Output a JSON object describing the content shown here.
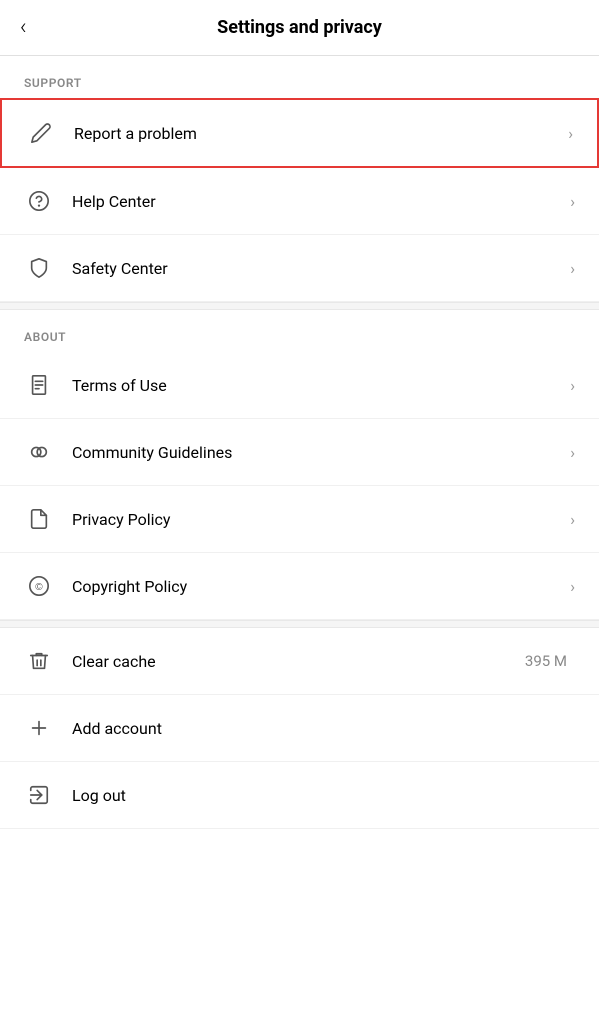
{
  "header": {
    "title": "Settings and privacy",
    "back_label": "<"
  },
  "sections": [
    {
      "label": "SUPPORT",
      "items": [
        {
          "id": "report-problem",
          "label": "Report a problem",
          "icon": "edit-icon",
          "highlighted": true,
          "chevron": true,
          "value": ""
        },
        {
          "id": "help-center",
          "label": "Help Center",
          "icon": "help-icon",
          "highlighted": false,
          "chevron": true,
          "value": ""
        },
        {
          "id": "safety-center",
          "label": "Safety Center",
          "icon": "shield-icon",
          "highlighted": false,
          "chevron": true,
          "value": ""
        }
      ]
    },
    {
      "label": "ABOUT",
      "items": [
        {
          "id": "terms-of-use",
          "label": "Terms of Use",
          "icon": "document-icon",
          "highlighted": false,
          "chevron": true,
          "value": ""
        },
        {
          "id": "community-guidelines",
          "label": "Community Guidelines",
          "icon": "rings-icon",
          "highlighted": false,
          "chevron": true,
          "value": ""
        },
        {
          "id": "privacy-policy",
          "label": "Privacy Policy",
          "icon": "file-icon",
          "highlighted": false,
          "chevron": true,
          "value": ""
        },
        {
          "id": "copyright-policy",
          "label": "Copyright Policy",
          "icon": "copyright-icon",
          "highlighted": false,
          "chevron": true,
          "value": ""
        }
      ]
    }
  ],
  "bottom_items": [
    {
      "id": "clear-cache",
      "label": "Clear cache",
      "icon": "trash-icon",
      "value": "395 M",
      "chevron": false
    },
    {
      "id": "add-account",
      "label": "Add account",
      "icon": "plus-icon",
      "value": "",
      "chevron": false
    },
    {
      "id": "log-out",
      "label": "Log out",
      "icon": "logout-icon",
      "value": "",
      "chevron": false
    }
  ],
  "chevron_char": "›",
  "icons": {
    "back": "‹"
  }
}
